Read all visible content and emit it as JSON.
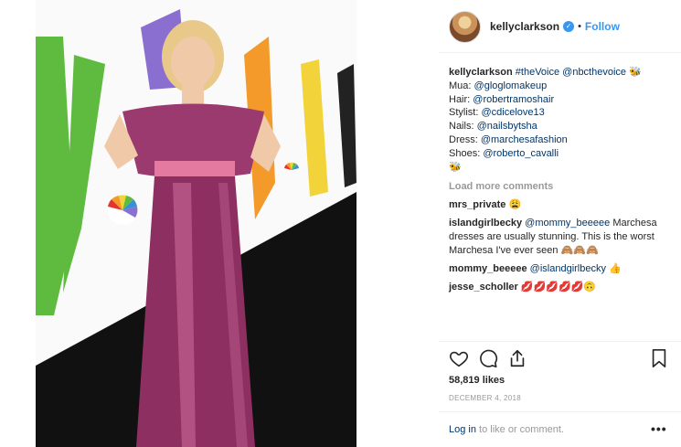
{
  "post": {
    "username": "kellyclarkson",
    "follow_label": "Follow",
    "caption_user": "kellyclarkson",
    "caption_tags": "#theVoice @nbcthevoice",
    "caption_lines": [
      {
        "label": "Mua:",
        "handle": "@gloglomakeup"
      },
      {
        "label": "Hair:",
        "handle": "@robertramoshair"
      },
      {
        "label": "Stylist:",
        "handle": "@cdicelove13"
      },
      {
        "label": "Nails:",
        "handle": "@nailsbytsha"
      },
      {
        "label": "Dress:",
        "handle": "@marchesafashion"
      },
      {
        "label": "Shoes:",
        "handle": "@roberto_cavalli"
      }
    ],
    "load_more": "Load more comments",
    "comments": [
      {
        "user": "mrs_private",
        "text": "😩"
      },
      {
        "user": "islandgirlbecky",
        "mention": "@mommy_beeeee",
        "text": "Marchesa dresses are usually stunning. This is the worst Marchesa I've ever seen 🙈🙈🙈"
      },
      {
        "user": "mommy_beeeee",
        "mention": "@islandgirlbecky",
        "text": "👍"
      },
      {
        "user": "jesse_scholler",
        "text": "💋💋💋💋💋🙃"
      }
    ],
    "likes": "58,819 likes",
    "date": "DECEMBER 4, 2018",
    "login_link": "Log in",
    "login_text": "to like or comment.",
    "more_label": "•••"
  },
  "icons": {
    "heart": "heart-icon",
    "comment": "comment-icon",
    "share": "share-icon",
    "bookmark": "bookmark-icon"
  },
  "colors": {
    "link": "#003569",
    "follow": "#3897f0",
    "muted": "#999999",
    "dress": "#9b3a6e",
    "floor": "#111111",
    "logo_green": "#5fbb3f",
    "logo_purple": "#8a6fd1",
    "logo_orange": "#f39a2b",
    "logo_yellow": "#f2d43a"
  }
}
